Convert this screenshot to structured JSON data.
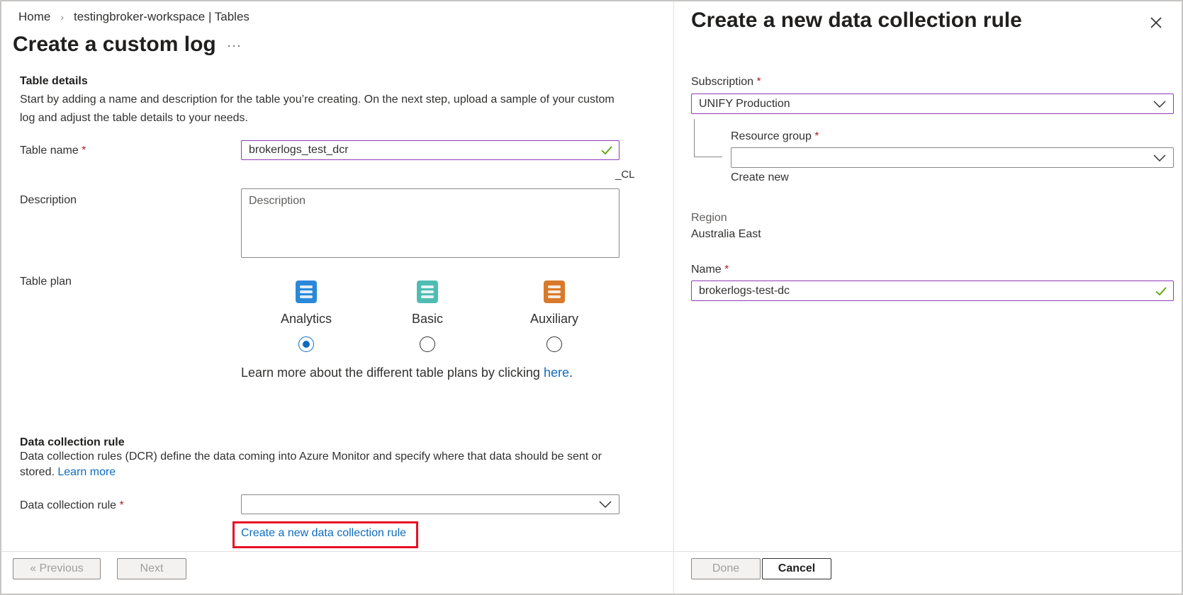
{
  "breadcrumb": {
    "home": "Home",
    "workspace": "testingbroker-workspace | Tables"
  },
  "page": {
    "title": "Create a custom log",
    "more": "···"
  },
  "table_details": {
    "title": "Table details",
    "description": "Start by adding a name and description for the table you’re creating. On the next step, upload a sample of your custom log and adjust the table details to your needs.",
    "table_name_label": "Table name",
    "table_name_value": "brokerlogs_test_dcr",
    "suffix": "_CL",
    "description_label": "Description",
    "description_placeholder": "Description",
    "table_plan_label": "Table plan",
    "plans": [
      {
        "name": "Analytics",
        "selected": true,
        "color": "#2b88d8"
      },
      {
        "name": "Basic",
        "selected": false,
        "color": "#4fbdb3"
      },
      {
        "name": "Auxiliary",
        "selected": false,
        "color": "#d87a2b"
      }
    ],
    "plan_note": "Learn more about the different table plans by clicking ",
    "plan_note_link": "here",
    "plan_note_end": "."
  },
  "dcr_section": {
    "title": "Data collection rule",
    "description": "Data collection rules (DCR) define the data coming into Azure Monitor and specify where that data should be sent or stored.",
    "learn_more": "Learn more",
    "field_label": "Data collection rule",
    "field_value": "",
    "create_link": "Create a new data collection rule"
  },
  "footer": {
    "previous": "« Previous",
    "next": "Next"
  },
  "panel": {
    "title": "Create a new data collection rule",
    "subscription_label": "Subscription",
    "subscription_value": "UNIFY Production",
    "resource_group_label": "Resource group",
    "resource_group_value": "",
    "create_new": "Create new",
    "region_label": "Region",
    "region_value": "Australia East",
    "name_label": "Name",
    "name_value": "brokerlogs-test-dc",
    "done": "Done",
    "cancel": "Cancel"
  },
  "required_mark": "*",
  "colors": {
    "focus_border": "#8f3bb8",
    "link": "#0f6cbd",
    "required": "#a4262c",
    "highlight": "#e81123",
    "check": "#57a300"
  }
}
